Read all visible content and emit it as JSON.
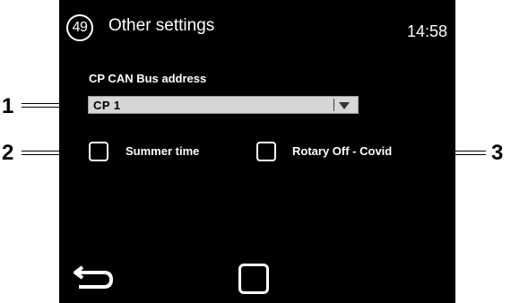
{
  "header": {
    "page_number": "49",
    "title": "Other settings",
    "time": "14:58"
  },
  "can_bus": {
    "label": "CP CAN Bus address",
    "selected_value": "CP 1"
  },
  "options": {
    "summer_time_label": "Summer time",
    "rotary_off_label": "Rotary Off - Covid"
  },
  "nav": {
    "back_icon": "back-arrow-icon",
    "home_icon": "home-square-icon"
  },
  "callouts": {
    "one": "1",
    "two": "2",
    "three": "3"
  },
  "colors": {
    "screen_bg": "#000000",
    "text": "#ffffff",
    "dropdown_bg": "#d6d6d6"
  }
}
